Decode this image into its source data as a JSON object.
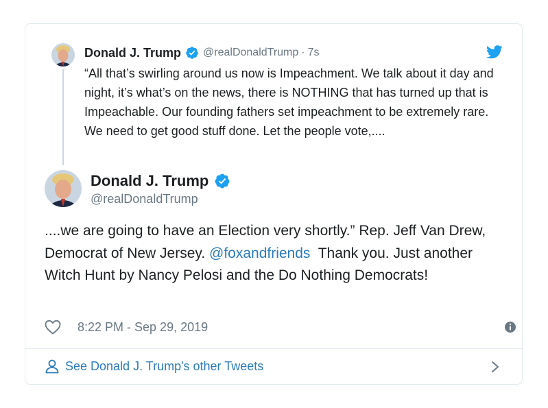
{
  "parent_tweet": {
    "name": "Donald J. Trump",
    "handle": "@realDonaldTrump",
    "separator": "·",
    "time": "7s",
    "text": "“All that’s swirling around us now is Impeachment. We talk about it day and night, it’s what’s on the news, there is NOTHING that has turned up that is Impeachable. Our founding fathers set impeachment to be extremely rare. We need to get good stuff done. Let the people vote,...."
  },
  "main_tweet": {
    "name": "Donald J. Trump",
    "handle": "@realDonaldTrump",
    "text_before": "....we are going to have an Election very shortly.” Rep. Jeff Van Drew, Democrat of New Jersey. ",
    "mention": "@foxandfriends",
    "text_after": "  Thank you. Just another Witch Hunt by Nancy Pelosi and the Do Nothing Democrats!",
    "timestamp": "8:22 PM - Sep 29, 2019"
  },
  "footer": {
    "link_label": "See Donald J. Trump's other Tweets"
  },
  "icons": {
    "verified": "verified-badge-icon",
    "bird": "twitter-bird-icon",
    "like": "heart-icon",
    "info": "info-icon",
    "person": "person-icon",
    "chevron": "chevron-right-icon"
  },
  "colors": {
    "brand_blue": "#1da1f2",
    "link_blue": "#2b7bb9",
    "secondary_text": "#697882",
    "border": "#e1e8ed"
  }
}
